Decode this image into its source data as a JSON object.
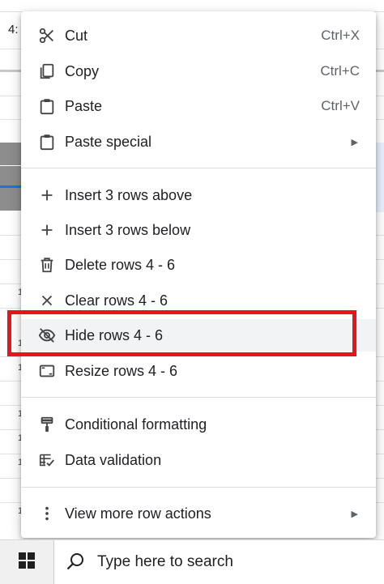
{
  "sheet": {
    "cell_reference": "4:",
    "row_marks": [
      "1",
      "1",
      "1",
      "1",
      "1",
      "1",
      "1"
    ]
  },
  "menu": {
    "items": [
      {
        "label": "Cut",
        "shortcut": "Ctrl+X",
        "icon": "scissors-icon"
      },
      {
        "label": "Copy",
        "shortcut": "Ctrl+C",
        "icon": "copy-icon"
      },
      {
        "label": "Paste",
        "shortcut": "Ctrl+V",
        "icon": "clipboard-icon"
      },
      {
        "label": "Paste special",
        "submenu_arrow": "▶",
        "icon": "clipboard-icon"
      },
      {
        "label": "Insert 3 rows above",
        "icon": "plus-icon"
      },
      {
        "label": "Insert 3 rows below",
        "icon": "plus-icon"
      },
      {
        "label": "Delete rows 4 - 6",
        "icon": "trash-icon"
      },
      {
        "label": "Clear rows 4 - 6",
        "icon": "close-icon"
      },
      {
        "label": "Hide rows 4 - 6",
        "icon": "eye-off-icon",
        "highlighted": true
      },
      {
        "label": "Resize rows 4 - 6",
        "icon": "resize-icon"
      },
      {
        "label": "Conditional formatting",
        "icon": "paint-roller-icon"
      },
      {
        "label": "Data validation",
        "icon": "data-validation-icon"
      },
      {
        "label": "View more row actions",
        "submenu_arrow": "▶",
        "icon": "more-vert-icon"
      }
    ]
  },
  "taskbar": {
    "search_placeholder": "Type here to search",
    "start_icon": "windows-logo-icon",
    "search_icon": "magnifier-icon"
  },
  "colors": {
    "highlight_border": "#e4161c",
    "selected_row_header": "#8d8d8d",
    "selection_blue": "#1a73e8",
    "hover_background": "#f1f3f4"
  }
}
